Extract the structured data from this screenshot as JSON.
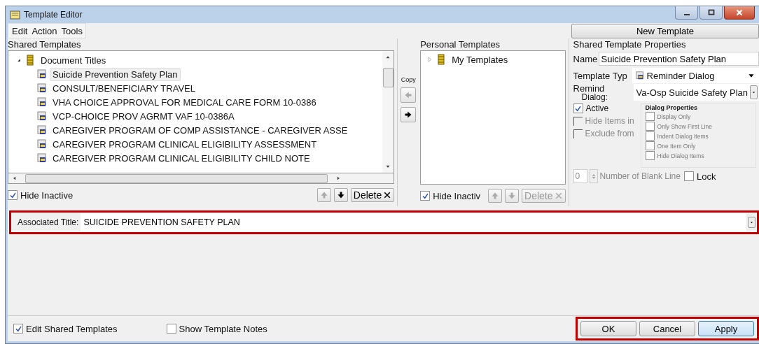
{
  "window": {
    "title": "Template Editor"
  },
  "menu": [
    "Edit",
    "Action",
    "Tools"
  ],
  "new_template_button": "New Template",
  "shared_templates": {
    "label": "Shared Templates",
    "root": {
      "label": "Document Titles",
      "expanded": true,
      "children": [
        {
          "label": "Suicide Prevention Safety Plan",
          "selected": true
        },
        {
          "label": "CONSULT/BENEFICIARY TRAVEL",
          "selected": false
        },
        {
          "label": "VHA CHOICE APPROVAL FOR MEDICAL CARE FORM 10-0386",
          "selected": false
        },
        {
          "label": "VCP-CHOICE PROV AGRMT VAF 10-0386A",
          "selected": false
        },
        {
          "label": "CAREGIVER PROGRAM OF COMP ASSISTANCE - CAREGIVER ASSE",
          "selected": false
        },
        {
          "label": "CAREGIVER PROGRAM CLINICAL ELIGIBILITY ASSESSMENT",
          "selected": false
        },
        {
          "label": "CAREGIVER PROGRAM CLINICAL ELIGIBILITY CHILD NOTE",
          "selected": false
        }
      ]
    },
    "hide_inactive": {
      "label": "Hide Inactive",
      "checked": true
    },
    "buttons": [
      {
        "kind": "up",
        "disabled": true
      },
      {
        "kind": "down",
        "disabled": false
      },
      {
        "kind": "delete",
        "label": "Delete",
        "disabled": false
      }
    ]
  },
  "copy": {
    "label": "Copy",
    "buttons": [
      {
        "kind": "left",
        "disabled": true
      },
      {
        "kind": "right",
        "disabled": false
      }
    ]
  },
  "personal_templates": {
    "label": "Personal Templates",
    "root": {
      "label": "My Templates",
      "expanded": false
    },
    "hide_inactive": {
      "label": "Hide Inactiv",
      "checked": true
    },
    "buttons": [
      {
        "kind": "up",
        "disabled": true
      },
      {
        "kind": "down",
        "disabled": true
      },
      {
        "kind": "delete",
        "label": "Delete",
        "disabled": true
      }
    ]
  },
  "properties": {
    "title": "Shared Template Properties",
    "name": {
      "label": "Name",
      "value": "Suicide Prevention Safety Plan"
    },
    "template_type": {
      "label": "Template Typ",
      "value": "Reminder Dialog"
    },
    "reminder_dialog": {
      "label": [
        "Remind",
        "Dialog:"
      ],
      "value": "Va-Osp Suicide Safety Plan"
    },
    "options": [
      {
        "label": "Active",
        "checked": true,
        "disabled": false
      },
      {
        "label": "Hide Items in",
        "checked": false,
        "disabled": true
      },
      {
        "label": "Exclude from",
        "checked": false,
        "disabled": true
      }
    ],
    "dialog_properties": {
      "title": "Dialog Properties",
      "items": [
        {
          "label": "Display Only",
          "checked": false
        },
        {
          "label": "Only Show First Line",
          "checked": false
        },
        {
          "label": "Indent Dialog Items",
          "checked": false
        },
        {
          "label": "One Item Only",
          "checked": false
        },
        {
          "label": "Hide Dialog Items",
          "checked": false
        }
      ]
    },
    "blank_lines": {
      "value": "0",
      "label": "Number of Blank Line"
    },
    "lock": {
      "label": "Lock",
      "checked": false
    }
  },
  "associated_title": {
    "label": "Associated Title:",
    "value": "SUICIDE PREVENTION SAFETY PLAN",
    "highlighted": true
  },
  "footer": {
    "checks": [
      {
        "label": "Edit Shared Templates",
        "checked": true
      },
      {
        "label": "Show Template Notes",
        "checked": false
      }
    ],
    "buttons": [
      {
        "label": "OK",
        "default": false
      },
      {
        "label": "Cancel",
        "default": false
      },
      {
        "label": "Apply",
        "default": true
      }
    ],
    "highlighted": true
  }
}
